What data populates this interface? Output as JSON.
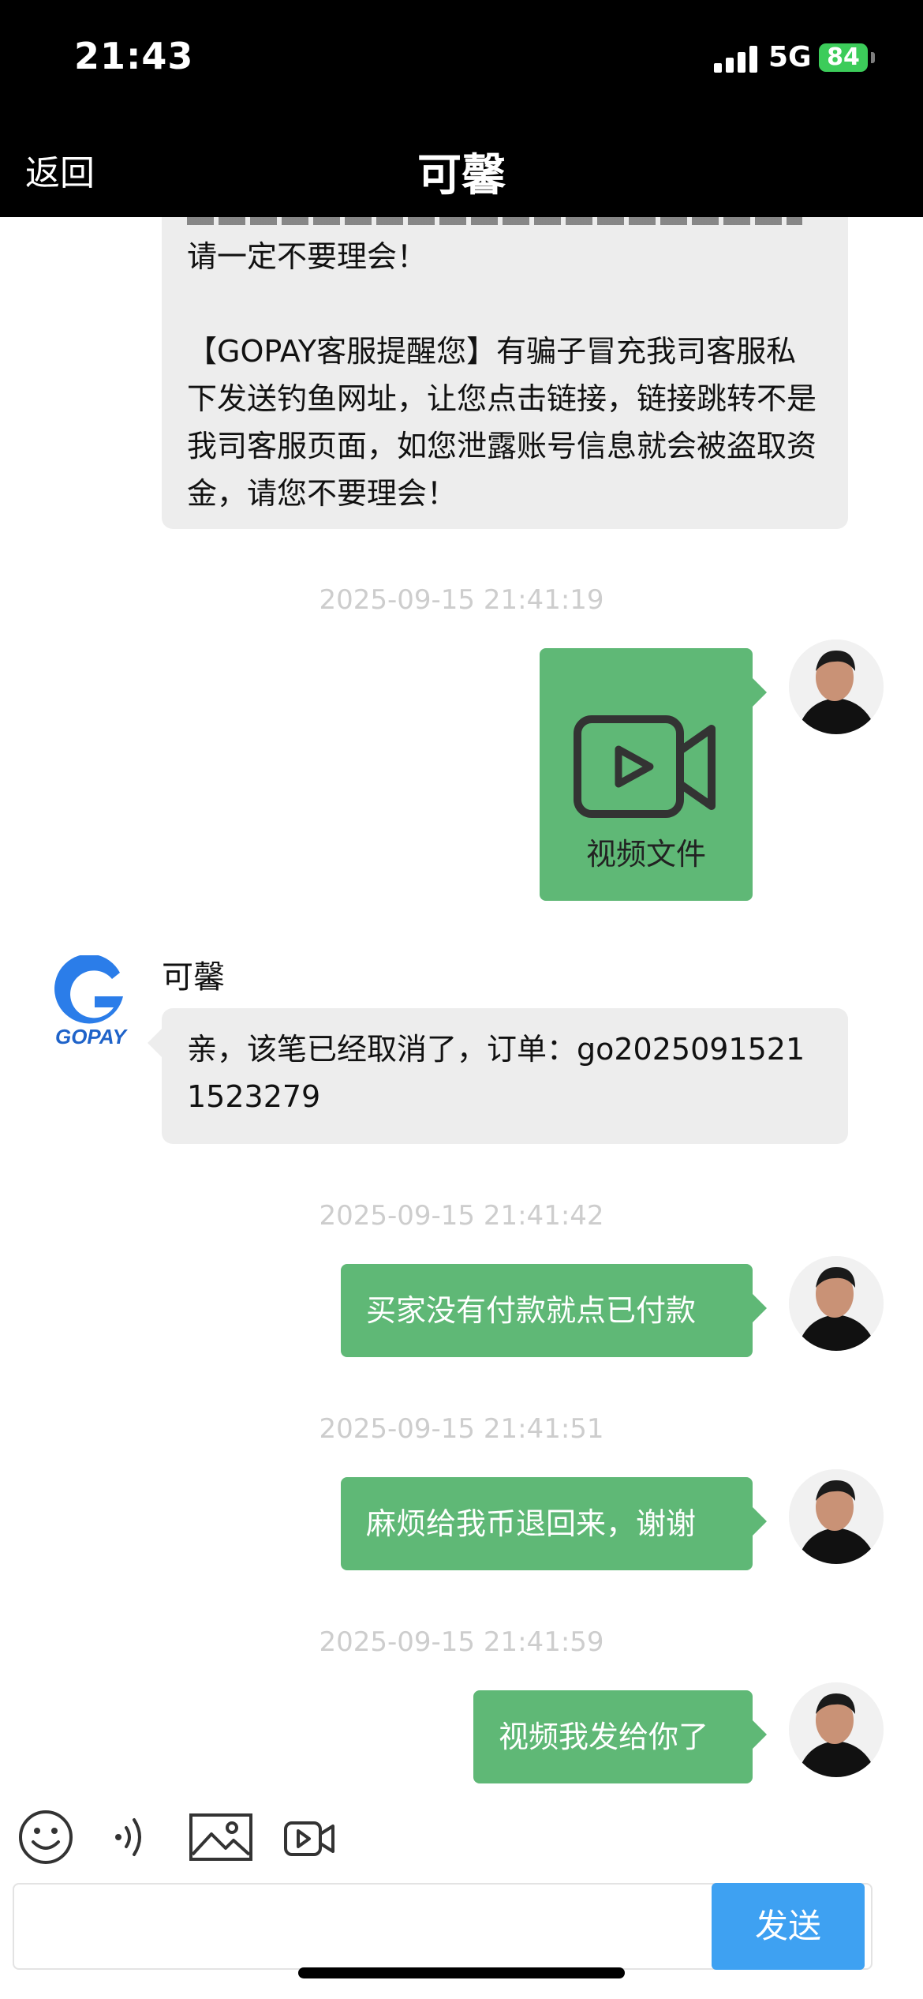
{
  "status_bar": {
    "time": "21:43",
    "network": "5G",
    "battery": "84"
  },
  "nav": {
    "back_label": "返回",
    "title": "可馨"
  },
  "messages": {
    "m1": {
      "line1": "请一定不要理会！",
      "para2": "【GOPAY客服提醒您】有骗子冒充我司客服私下发送钓鱼网址，让您点击链接，链接跳转不是我司客服页面，如您泄露账号信息就会被盗取资金，请您不要理会！"
    },
    "ts1": "2025-09-15 21:41:19",
    "video_label": "视频文件",
    "sender_name": "可馨",
    "gopay_logo_text": "GOPAY",
    "m2": "亲，该笔已经取消了，订单：go20250915211523279",
    "ts2": "2025-09-15 21:41:42",
    "m3": "买家没有付款就点已付款",
    "ts3": "2025-09-15 21:41:51",
    "m4": "麻烦给我币退回来，谢谢",
    "ts4": "2025-09-15 21:41:59",
    "m5": "视频我发给你了"
  },
  "toolbar": {
    "icons": [
      "emoji-icon",
      "voice-icon",
      "image-icon",
      "video-icon"
    ]
  },
  "input": {
    "placeholder": "",
    "send_label": "发送"
  },
  "colors": {
    "bubble_right": "#5fb876",
    "bubble_left": "#ededed",
    "send_button": "#3ea1f2",
    "header": "#000000"
  }
}
